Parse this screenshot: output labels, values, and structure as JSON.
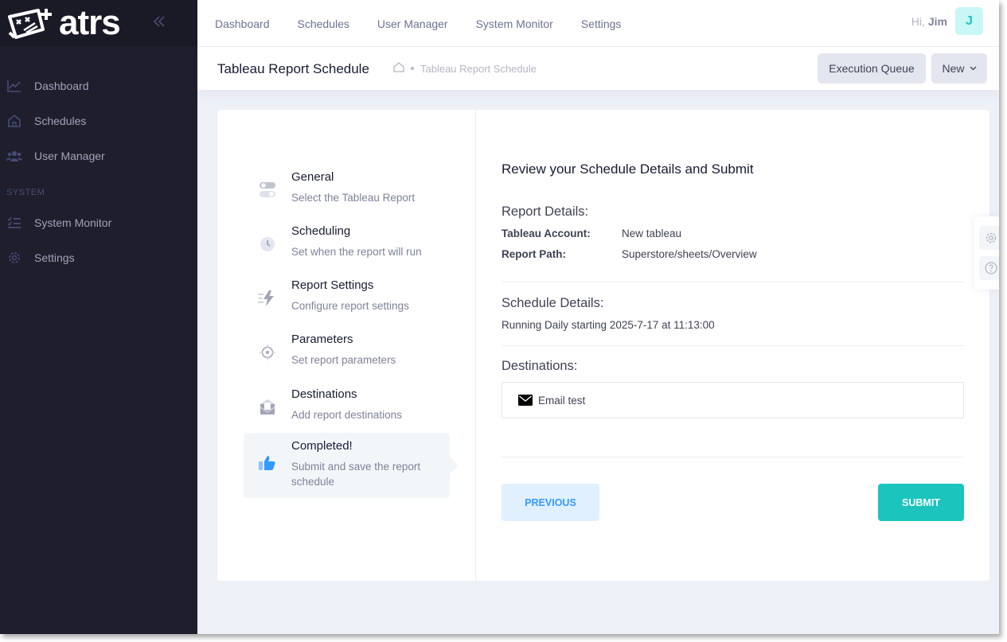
{
  "brand": {
    "logo_text": "atrs"
  },
  "sidebar": {
    "items": [
      {
        "label": "Dashboard",
        "icon": "chart-line-icon"
      },
      {
        "label": "Schedules",
        "icon": "home-icon"
      },
      {
        "label": "User Manager",
        "icon": "users-icon"
      }
    ],
    "section_label": "SYSTEM",
    "system_items": [
      {
        "label": "System Monitor",
        "icon": "list-check-icon"
      },
      {
        "label": "Settings",
        "icon": "gear-icon"
      }
    ]
  },
  "topnav": {
    "links": [
      "Dashboard",
      "Schedules",
      "User Manager",
      "System Monitor",
      "Settings"
    ]
  },
  "user": {
    "greeting": "Hi,",
    "name": "Jim",
    "initial": "J"
  },
  "subheader": {
    "title": "Tableau Report Schedule",
    "breadcrumb_current": "Tableau Report Schedule",
    "execution_queue_label": "Execution Queue",
    "new_label": "New"
  },
  "wizard": {
    "steps": [
      {
        "title": "General",
        "desc": "Select the Tableau Report",
        "icon": "toggle-icon"
      },
      {
        "title": "Scheduling",
        "desc": "Set when the report will run",
        "icon": "clock-icon"
      },
      {
        "title": "Report Settings",
        "desc": "Configure report settings",
        "icon": "lightning-icon"
      },
      {
        "title": "Parameters",
        "desc": "Set report parameters",
        "icon": "target-icon"
      },
      {
        "title": "Destinations",
        "desc": "Add report destinations",
        "icon": "mailbox-icon"
      },
      {
        "title": "Completed!",
        "desc": "Submit and save the report schedule",
        "icon": "thumbs-up-icon"
      }
    ]
  },
  "review": {
    "title": "Review your Schedule Details and Submit",
    "report_heading": "Report Details:",
    "account_label": "Tableau Account:",
    "account_value": "New tableau",
    "path_label": "Report Path:",
    "path_value": "Superstore/sheets/Overview",
    "schedule_heading": "Schedule Details:",
    "schedule_text": "Running Daily starting 2025-7-17 at 11:13:00",
    "destinations_heading": "Destinations:",
    "destination_item": "Email test",
    "previous_label": "PREVIOUS",
    "submit_label": "SUBMIT"
  },
  "colors": {
    "sidebar_bg": "#1e1e2d",
    "accent_teal": "#1bc5bd",
    "primary_blue": "#3699ff"
  }
}
